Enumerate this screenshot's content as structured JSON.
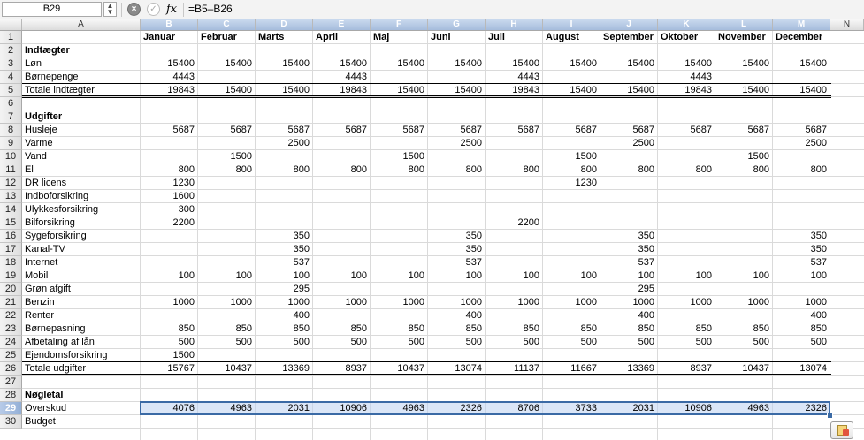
{
  "formula_bar": {
    "name_box": "B29",
    "fx_label": "fx",
    "formula": "=B5–B26"
  },
  "columns": [
    "A",
    "B",
    "C",
    "D",
    "E",
    "F",
    "G",
    "H",
    "I",
    "J",
    "K",
    "L",
    "M",
    "N"
  ],
  "selected_columns": [
    "B",
    "C",
    "D",
    "E",
    "F",
    "G",
    "H",
    "I",
    "J",
    "K",
    "L",
    "M"
  ],
  "selected_row": 29,
  "rows": [
    {
      "n": 1,
      "a": "",
      "values": [
        "Januar",
        "Februar",
        "Marts",
        "April",
        "Maj",
        "Juni",
        "Juli",
        "August",
        "September",
        "Oktober",
        "November",
        "December"
      ],
      "header": true
    },
    {
      "n": 2,
      "a": "Indtægter",
      "bold": true,
      "values": []
    },
    {
      "n": 3,
      "a": "Løn",
      "values": [
        "15400",
        "15400",
        "15400",
        "15400",
        "15400",
        "15400",
        "15400",
        "15400",
        "15400",
        "15400",
        "15400",
        "15400"
      ]
    },
    {
      "n": 4,
      "a": "Børnepenge",
      "values": [
        "4443",
        "",
        "",
        "4443",
        "",
        "",
        "4443",
        "",
        "",
        "4443",
        "",
        ""
      ]
    },
    {
      "n": 5,
      "a": "Totale indtægter",
      "values": [
        "19843",
        "15400",
        "15400",
        "19843",
        "15400",
        "15400",
        "19843",
        "15400",
        "15400",
        "19843",
        "15400",
        "15400"
      ]
    },
    {
      "n": 6,
      "a": "",
      "values": []
    },
    {
      "n": 7,
      "a": "Udgifter",
      "bold": true,
      "values": []
    },
    {
      "n": 8,
      "a": "Husleje",
      "values": [
        "5687",
        "5687",
        "5687",
        "5687",
        "5687",
        "5687",
        "5687",
        "5687",
        "5687",
        "5687",
        "5687",
        "5687"
      ]
    },
    {
      "n": 9,
      "a": "Varme",
      "values": [
        "",
        "",
        "2500",
        "",
        "",
        "2500",
        "",
        "",
        "2500",
        "",
        "",
        "2500"
      ]
    },
    {
      "n": 10,
      "a": "Vand",
      "values": [
        "",
        "1500",
        "",
        "",
        "1500",
        "",
        "",
        "1500",
        "",
        "",
        "1500",
        ""
      ]
    },
    {
      "n": 11,
      "a": "El",
      "values": [
        "800",
        "800",
        "800",
        "800",
        "800",
        "800",
        "800",
        "800",
        "800",
        "800",
        "800",
        "800"
      ]
    },
    {
      "n": 12,
      "a": "DR licens",
      "values": [
        "1230",
        "",
        "",
        "",
        "",
        "",
        "",
        "1230",
        "",
        "",
        "",
        ""
      ]
    },
    {
      "n": 13,
      "a": "Indboforsikring",
      "values": [
        "1600"
      ]
    },
    {
      "n": 14,
      "a": "Ulykkesforsikring",
      "values": [
        "300"
      ]
    },
    {
      "n": 15,
      "a": "Bilforsikring",
      "values": [
        "2200",
        "",
        "",
        "",
        "",
        "",
        "2200",
        "",
        "",
        "",
        "",
        ""
      ]
    },
    {
      "n": 16,
      "a": "Sygeforsikring",
      "values": [
        "",
        "",
        "350",
        "",
        "",
        "350",
        "",
        "",
        "350",
        "",
        "",
        "350"
      ]
    },
    {
      "n": 17,
      "a": "Kanal-TV",
      "values": [
        "",
        "",
        "350",
        "",
        "",
        "350",
        "",
        "",
        "350",
        "",
        "",
        "350"
      ]
    },
    {
      "n": 18,
      "a": "Internet",
      "values": [
        "",
        "",
        "537",
        "",
        "",
        "537",
        "",
        "",
        "537",
        "",
        "",
        "537"
      ]
    },
    {
      "n": 19,
      "a": "Mobil",
      "values": [
        "100",
        "100",
        "100",
        "100",
        "100",
        "100",
        "100",
        "100",
        "100",
        "100",
        "100",
        "100"
      ]
    },
    {
      "n": 20,
      "a": "Grøn afgift",
      "values": [
        "",
        "",
        "295",
        "",
        "",
        "",
        "",
        "",
        "295",
        "",
        "",
        ""
      ]
    },
    {
      "n": 21,
      "a": "Benzin",
      "values": [
        "1000",
        "1000",
        "1000",
        "1000",
        "1000",
        "1000",
        "1000",
        "1000",
        "1000",
        "1000",
        "1000",
        "1000"
      ]
    },
    {
      "n": 22,
      "a": "Renter",
      "values": [
        "",
        "",
        "400",
        "",
        "",
        "400",
        "",
        "",
        "400",
        "",
        "",
        "400"
      ]
    },
    {
      "n": 23,
      "a": "Børnepasning",
      "values": [
        "850",
        "850",
        "850",
        "850",
        "850",
        "850",
        "850",
        "850",
        "850",
        "850",
        "850",
        "850"
      ]
    },
    {
      "n": 24,
      "a": "Afbetaling af lån",
      "values": [
        "500",
        "500",
        "500",
        "500",
        "500",
        "500",
        "500",
        "500",
        "500",
        "500",
        "500",
        "500"
      ]
    },
    {
      "n": 25,
      "a": "Ejendomsforsikring",
      "values": [
        "1500"
      ]
    },
    {
      "n": 26,
      "a": "Totale udgifter",
      "values": [
        "15767",
        "10437",
        "13369",
        "8937",
        "10437",
        "13074",
        "11137",
        "11667",
        "13369",
        "8937",
        "10437",
        "13074"
      ]
    },
    {
      "n": 27,
      "a": "",
      "values": []
    },
    {
      "n": 28,
      "a": "Nøgletal",
      "bold": true,
      "values": []
    },
    {
      "n": 29,
      "a": "Overskud",
      "values": [
        "4076",
        "4963",
        "2031",
        "10906",
        "4963",
        "2326",
        "8706",
        "3733",
        "2031",
        "10906",
        "4963",
        "2326"
      ]
    },
    {
      "n": 30,
      "a": "Budget",
      "values": []
    }
  ]
}
